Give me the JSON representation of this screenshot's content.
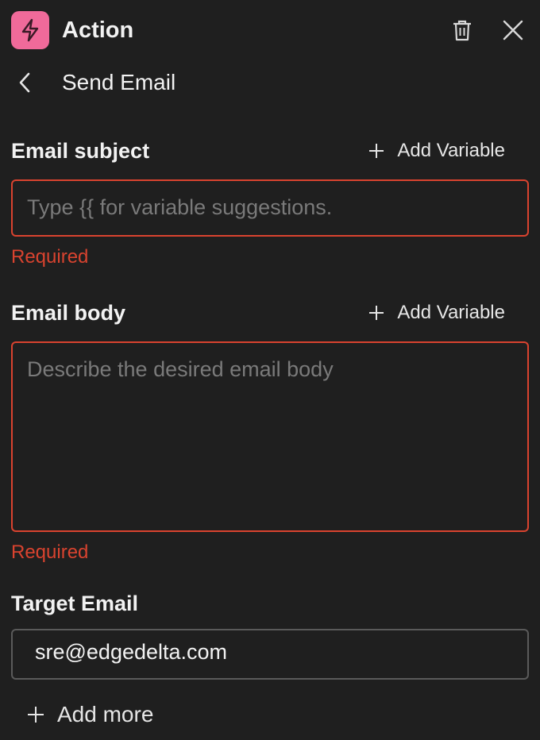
{
  "colors": {
    "accent": "#f06a9a",
    "error": "#d9432f"
  },
  "header": {
    "title": "Action",
    "icon": "lightning-icon",
    "delete_icon": "trash-icon",
    "close_icon": "close-icon"
  },
  "sub_header": {
    "title": "Send Email",
    "back_icon": "chevron-left-icon"
  },
  "email_subject": {
    "label": "Email subject",
    "add_variable": "Add Variable",
    "placeholder": "Type {{ for variable suggestions.",
    "error": "Required"
  },
  "email_body": {
    "label": "Email body",
    "add_variable": "Add Variable",
    "placeholder": "Describe the desired email body",
    "error": "Required"
  },
  "target_email": {
    "label": "Target Email",
    "value": "sre@edgedelta.com",
    "add_more": "Add more"
  }
}
